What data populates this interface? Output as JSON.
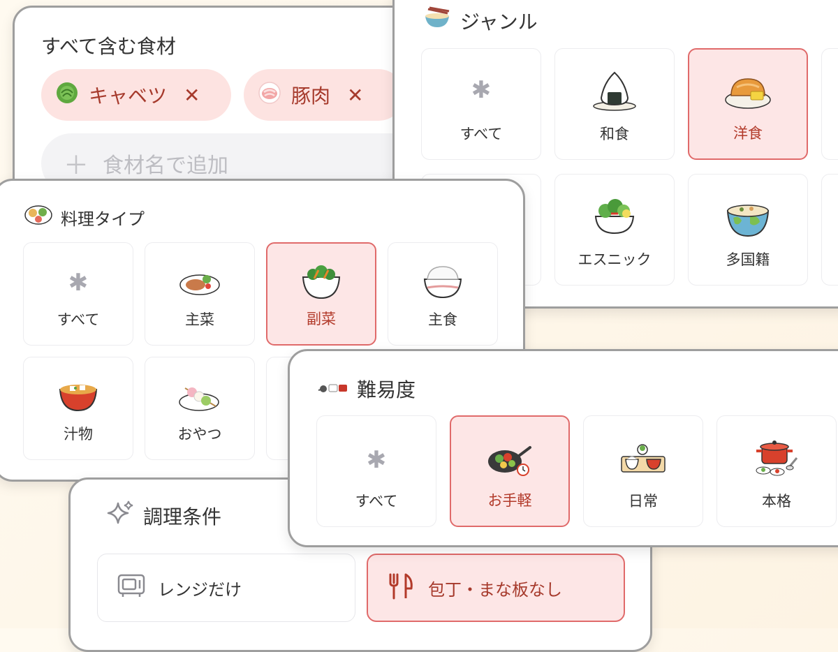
{
  "ingredients": {
    "title": "すべて含む食材",
    "chips": [
      {
        "label": "キャベツ",
        "remove": "✕",
        "icon": "cabbage-icon"
      },
      {
        "label": "豚肉",
        "remove": "✕",
        "icon": "pork-icon"
      }
    ],
    "add_placeholder": "食材名で追加",
    "add_icon": "plus-icon"
  },
  "genre": {
    "title": "ジャンル",
    "icon": "bowl-chopsticks-icon",
    "items": [
      {
        "label": "すべて",
        "icon": "asterisk-icon",
        "selected": false
      },
      {
        "label": "和食",
        "icon": "onigiri-icon",
        "selected": false
      },
      {
        "label": "洋食",
        "icon": "bread-icon",
        "selected": true
      },
      {
        "label": "エスニック",
        "icon": "salad-bowl-icon",
        "selected": false
      },
      {
        "label": "多国籍",
        "icon": "globe-bowl-icon",
        "selected": false
      }
    ]
  },
  "dish_type": {
    "title": "料理タイプ",
    "icon": "bento-icon",
    "items": [
      {
        "label": "すべて",
        "icon": "asterisk-icon",
        "selected": false
      },
      {
        "label": "主菜",
        "icon": "main-dish-icon",
        "selected": false
      },
      {
        "label": "副菜",
        "icon": "side-dish-icon",
        "selected": true
      },
      {
        "label": "主食",
        "icon": "rice-bowl-icon",
        "selected": false
      },
      {
        "label": "汁物",
        "icon": "miso-soup-icon",
        "selected": false
      },
      {
        "label": "おやつ",
        "icon": "dango-icon",
        "selected": false
      }
    ]
  },
  "difficulty": {
    "title": "難易度",
    "icon": "cookware-icon",
    "items": [
      {
        "label": "すべて",
        "icon": "asterisk-icon",
        "selected": false
      },
      {
        "label": "お手軽",
        "icon": "frying-pan-icon",
        "selected": true
      },
      {
        "label": "日常",
        "icon": "meal-tray-icon",
        "selected": false
      },
      {
        "label": "本格",
        "icon": "pot-icon",
        "selected": false
      }
    ]
  },
  "conditions": {
    "title": "調理条件",
    "icon": "sparkle-icon",
    "options": [
      {
        "label": "レンジだけ",
        "icon": "microwave-icon",
        "selected": false
      },
      {
        "label": "包丁・まな板なし",
        "icon": "fork-knife-icon",
        "selected": true
      }
    ]
  },
  "colors": {
    "accent": "#e06a6a",
    "accent_bg": "#fde6e6",
    "accent_text": "#a63a2c",
    "card_border": "#9e9e9e"
  }
}
